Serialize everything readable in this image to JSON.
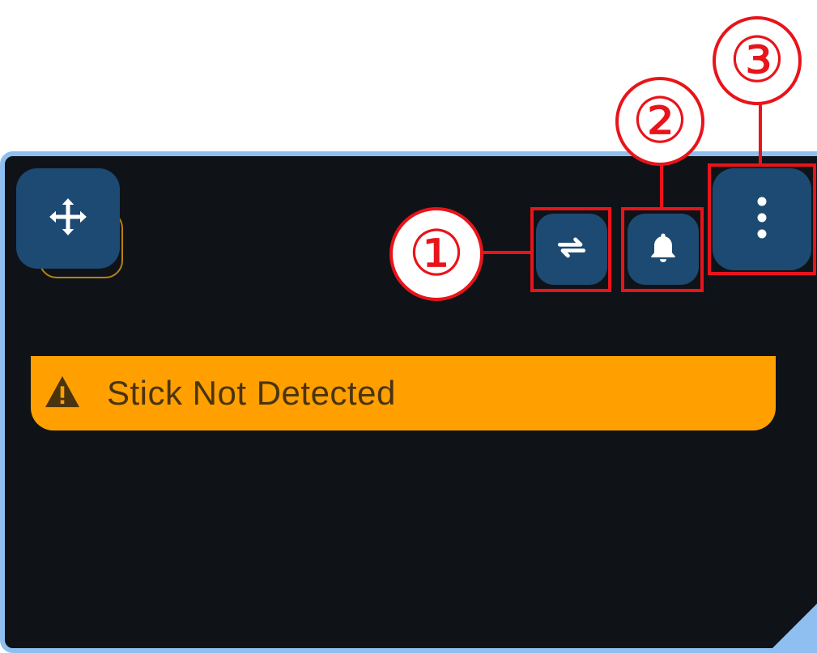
{
  "widget": {
    "warning": {
      "text": "Stick Not Detected",
      "icon": "warning-triangle-icon",
      "color": "#ffa000"
    },
    "buttons": {
      "move": {
        "icon": "move-arrows-icon"
      },
      "sync": {
        "icon": "sync-icon"
      },
      "notifications": {
        "icon": "bell-icon"
      },
      "more": {
        "icon": "more-vertical-icon"
      }
    }
  },
  "annotations": {
    "callout_1": "①",
    "callout_2": "②",
    "callout_3": "③",
    "color": "#e8141a"
  },
  "colors": {
    "panel_bg": "#0f1318",
    "panel_border": "#8fbff0",
    "button_bg": "#1d4a72"
  }
}
